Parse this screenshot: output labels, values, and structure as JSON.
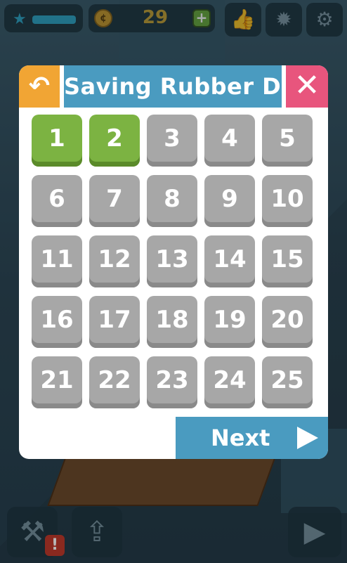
{
  "hud": {
    "coins": "29",
    "plus_label": "+",
    "coin_symbol": "¢"
  },
  "modal": {
    "title": "Saving Rubber Duck",
    "next_label": "Next"
  },
  "levels": [
    {
      "n": "1",
      "state": "unlocked"
    },
    {
      "n": "2",
      "state": "unlocked"
    },
    {
      "n": "3",
      "state": "locked"
    },
    {
      "n": "4",
      "state": "locked"
    },
    {
      "n": "5",
      "state": "locked"
    },
    {
      "n": "6",
      "state": "locked"
    },
    {
      "n": "7",
      "state": "locked"
    },
    {
      "n": "8",
      "state": "locked"
    },
    {
      "n": "9",
      "state": "locked"
    },
    {
      "n": "10",
      "state": "locked"
    },
    {
      "n": "11",
      "state": "locked"
    },
    {
      "n": "12",
      "state": "locked"
    },
    {
      "n": "13",
      "state": "locked"
    },
    {
      "n": "14",
      "state": "locked"
    },
    {
      "n": "15",
      "state": "locked"
    },
    {
      "n": "16",
      "state": "locked"
    },
    {
      "n": "17",
      "state": "locked"
    },
    {
      "n": "18",
      "state": "locked"
    },
    {
      "n": "19",
      "state": "locked"
    },
    {
      "n": "20",
      "state": "locked"
    },
    {
      "n": "21",
      "state": "locked"
    },
    {
      "n": "22",
      "state": "locked"
    },
    {
      "n": "23",
      "state": "locked"
    },
    {
      "n": "24",
      "state": "locked"
    },
    {
      "n": "25",
      "state": "locked"
    }
  ],
  "icons": {
    "back": "back-arrow-icon",
    "close": "close-icon",
    "next": "play-icon",
    "like": "thumbs-up-icon",
    "achievements": "gear-badge-icon",
    "settings": "gear-icon",
    "tools": "tools-icon",
    "share": "share-icon",
    "alert": "!"
  },
  "colors": {
    "unlocked": "#7cb342",
    "locked": "#a7a7a7",
    "header_blue": "#4a9bc0",
    "back_orange": "#f1a534",
    "close_pink": "#e8557d"
  }
}
